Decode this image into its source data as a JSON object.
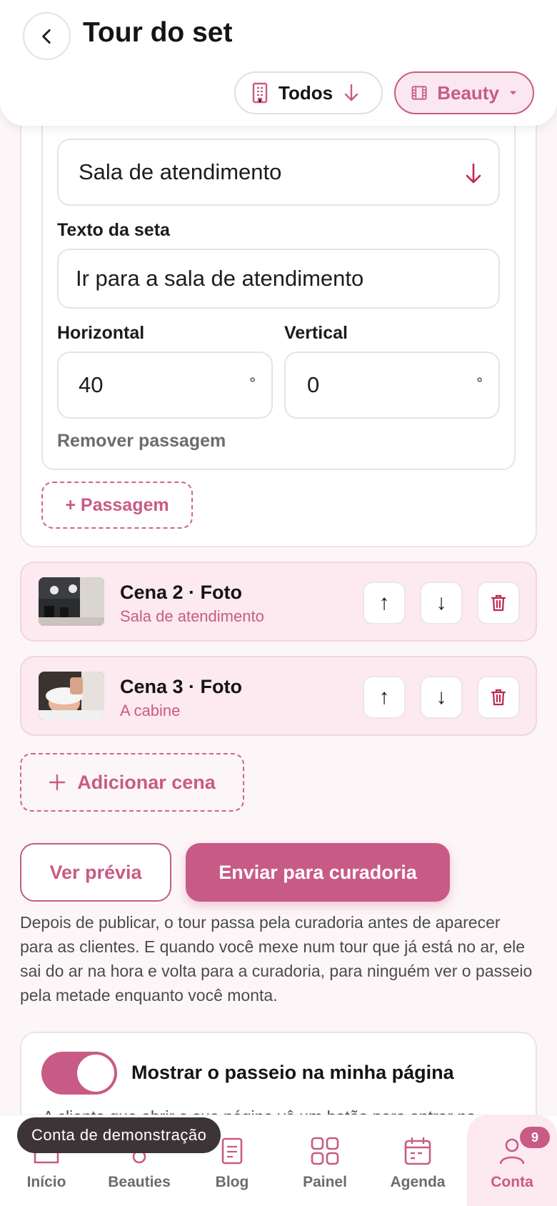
{
  "header": {
    "title": "Tour do set",
    "filter_todos": "Todos",
    "filter_beauty": "Beauty"
  },
  "passage": {
    "destination_value": "Sala de atendimento",
    "arrow_text_label": "Texto da seta",
    "arrow_text_value": "Ir para a sala de atendimento",
    "horizontal_label": "Horizontal",
    "horizontal_value": "40",
    "vertical_label": "Vertical",
    "vertical_value": "0",
    "degree_symbol": "°",
    "remove_label": "Remover passagem",
    "add_passage_label": "+ Passagem"
  },
  "scenes": [
    {
      "title": "Cena 2 · Foto",
      "subtitle": "Sala de atendimento"
    },
    {
      "title": "Cena 3 · Foto",
      "subtitle": "A cabine"
    }
  ],
  "add_scene_label": "Adicionar cena",
  "actions": {
    "preview_label": "Ver prévia",
    "submit_label": "Enviar para curadoria"
  },
  "info_text": "Depois de publicar, o tour passa pela curadoria antes de aparecer para as clientes. E quando você mexe num tour que já está no ar, ele sai do ar na hora e volta para a curadoria, para ninguém ver o passeio pela metade enquanto você monta.",
  "toggle": {
    "label": "Mostrar o passeio na minha página",
    "description": "A cliente que abrir a sua página vê um botão para entrar no",
    "on": true
  },
  "demo_toast": "Conta de demonstração",
  "nav": {
    "items": [
      "Início",
      "Beauties",
      "Blog",
      "Painel",
      "Agenda",
      "Conta"
    ],
    "badge": "9",
    "active": "Conta"
  },
  "colors": {
    "accent": "#c85b85",
    "accent_light": "#fde9f0"
  }
}
